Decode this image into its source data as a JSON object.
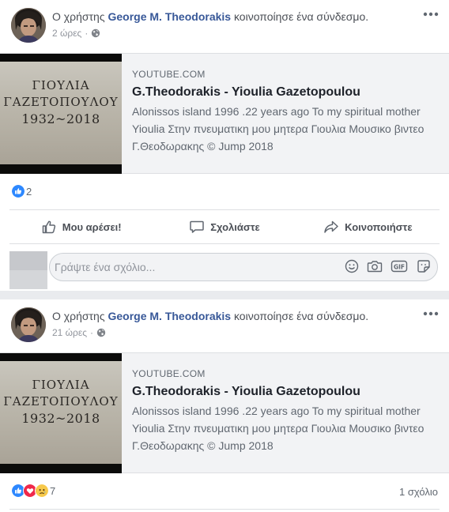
{
  "posts": [
    {
      "header": {
        "prefix": "Ο χρήστης",
        "author": "George M. Theodorakis",
        "action": "κοινοποίησε ένα σύνδεσμο."
      },
      "time": "2 ώρες",
      "privacy_icon": "globe-icon",
      "link": {
        "thumb_line1": "ΓΙΟΥΛΙΑ",
        "thumb_line2": "ΓΑΖΕΤΟΠΟΥΛΟΥ",
        "thumb_line3": "1932~2018",
        "source": "YOUTUBE.COM",
        "title": "G.Theodorakis - Yioulia Gazetopoulou",
        "description": "Alonissos island 1996 .22 years ago To my spiritual mother Yioulia Στην πνευματικη μου μητερα Γιουλια Μουσικο βιντεο Γ.Θεοδωρακης © Jump 2018"
      },
      "reactions": {
        "types": [
          "like"
        ],
        "count": "2"
      },
      "actions": {
        "like": "Μου αρέσει!",
        "comment": "Σχολιάστε",
        "share": "Κοινοποιήστε"
      },
      "comment_placeholder": "Γράψτε ένα σχόλιο...",
      "comment_icons": [
        "emoji-icon",
        "camera-icon",
        "gif-icon",
        "sticker-icon"
      ]
    },
    {
      "header": {
        "prefix": "Ο χρήστης",
        "author": "George M. Theodorakis",
        "action": "κοινοποίησε ένα σύνδεσμο."
      },
      "time": "21 ώρες",
      "privacy_icon": "globe-icon",
      "link": {
        "thumb_line1": "ΓΙΟΥΛΙΑ",
        "thumb_line2": "ΓΑΖΕΤΟΠΟΥΛΟΥ",
        "thumb_line3": "1932~2018",
        "source": "YOUTUBE.COM",
        "title": "G.Theodorakis - Yioulia Gazetopoulou",
        "description": "Alonissos island 1996 .22 years ago To my spiritual mother Yioulia Στην πνευματικη μου μητερα Γιουλια Μουσικο βιντεο Γ.Θεοδωρακης © Jump 2018"
      },
      "reactions": {
        "types": [
          "like",
          "love",
          "sad"
        ],
        "count": "7"
      },
      "comments_count": "1 σχόλιο"
    }
  ],
  "colors": {
    "author": "#385898",
    "like": "#2d88ff",
    "love": "#f0284a",
    "sad": "#f7c94b",
    "background": "#e9ebee"
  }
}
